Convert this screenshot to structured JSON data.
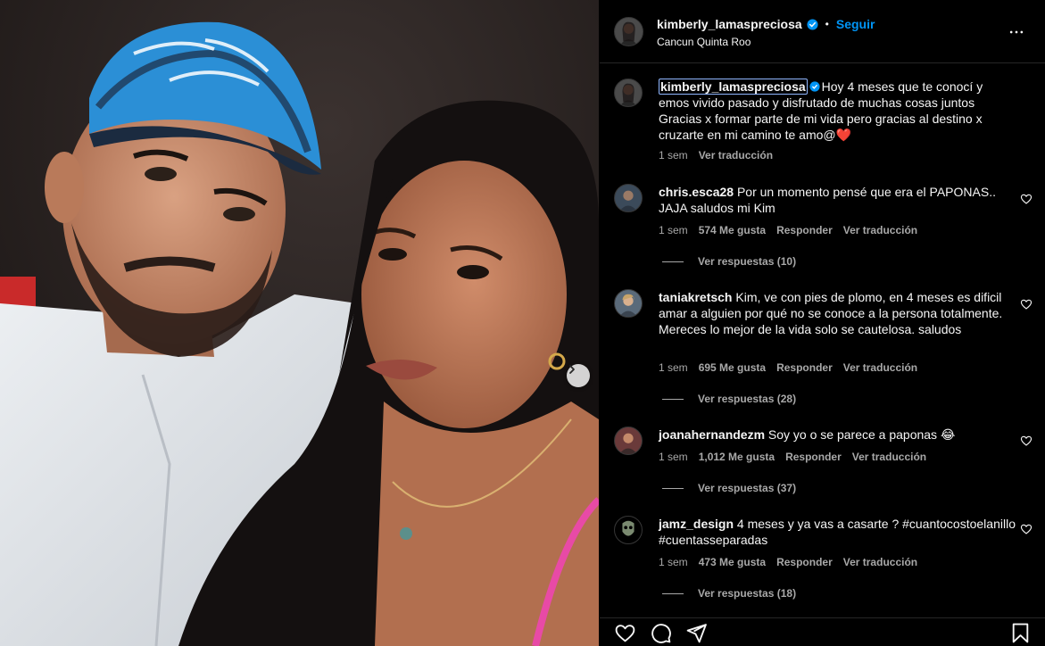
{
  "post": {
    "username": "kimberly_lamaspreciosa",
    "follow_label": "Seguir",
    "location": "Cancun Quinta Roo",
    "caption_author": "kimberly_lamaspreciosa",
    "caption_text": "Hoy 4 meses que te conocí y emos vivido pasado y disfrutado de muchas cosas juntos Gracias x formar parte de mi vida pero gracias al destino x cruzarte en mi camino te amo@❤️",
    "caption_time": "1 sem",
    "caption_translate": "Ver traducción"
  },
  "comments": [
    {
      "author": "chris.esca28",
      "text": "Por un momento pensé que era el PAPONAS.. JAJA saludos mi Kim",
      "time": "1 sem",
      "likes": "574 Me gusta",
      "reply": "Responder",
      "translate": "Ver traducción",
      "view_replies": "Ver respuestas (10)"
    },
    {
      "author": "taniakretsch",
      "text": "Kim, ve con pies de plomo, en 4 meses es dificil amar a alguien por qué no se conoce a la persona totalmente. Mereces lo mejor de la vida solo se cautelosa. saludos",
      "time": "1 sem",
      "likes": "695 Me gusta",
      "reply": "Responder",
      "translate": "Ver traducción",
      "view_replies": "Ver respuestas (28)"
    },
    {
      "author": "joanahernandezm",
      "text": "Soy yo o se parece a paponas 😂",
      "time": "1 sem",
      "likes": "1,012 Me gusta",
      "reply": "Responder",
      "translate": "Ver traducción",
      "view_replies": "Ver respuestas (37)"
    },
    {
      "author": "jamz_design",
      "text": "4 meses y ya vas a casarte ? #cuantocostoelanillo #cuentasseparadas",
      "time": "1 sem",
      "likes": "473 Me gusta",
      "reply": "Responder",
      "translate": "Ver traducción",
      "view_replies": "Ver respuestas (18)"
    }
  ],
  "icons": {
    "verified": "verified-badge-icon",
    "more": "more-options-icon",
    "like": "heart-icon",
    "comment": "comment-icon",
    "share": "send-icon",
    "save": "bookmark-icon",
    "carousel_next": "chevron-right-icon"
  },
  "colors": {
    "background": "#000000",
    "text": "#f5f5f5",
    "muted": "#a8a8a8",
    "accent": "#0095f6",
    "divider": "#262626"
  }
}
